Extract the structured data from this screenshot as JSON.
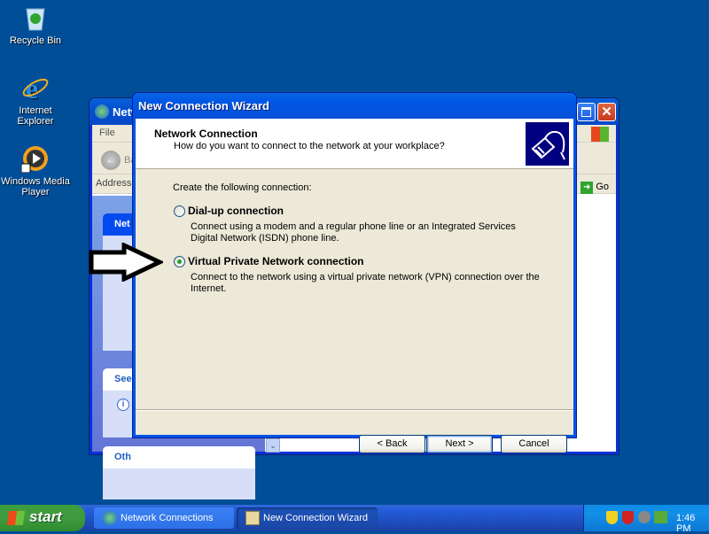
{
  "desktop": {
    "icons": [
      {
        "label": "Recycle Bin",
        "icon": "recycle-bin-icon"
      },
      {
        "label": "Internet Explorer",
        "icon": "internet-explorer-icon"
      },
      {
        "label": "Windows Media Player",
        "icon": "windows-media-player-icon"
      }
    ]
  },
  "background_window": {
    "title": "Network Connections",
    "title_visible": "Netw",
    "menu_file": "File",
    "back_label": "Ba",
    "address_label": "Address",
    "go_label": "Go",
    "panels": [
      "Net",
      "See",
      "Oth"
    ]
  },
  "wizard": {
    "title": "New Connection Wizard",
    "header_title": "Network Connection",
    "header_subtitle": "How do you want to connect to the network at your workplace?",
    "prompt": "Create the following connection:",
    "options": [
      {
        "label": "Dial-up connection",
        "description": "Connect using a modem and a regular phone line or an Integrated Services Digital Network (ISDN) phone line.",
        "selected": false
      },
      {
        "label": "Virtual Private Network connection",
        "description": "Connect to the network using a virtual private network (VPN) connection over the Internet.",
        "selected": true
      }
    ],
    "buttons": {
      "back": "< Back",
      "next": "Next >",
      "cancel": "Cancel"
    }
  },
  "taskbar": {
    "start_label": "start",
    "tasks": [
      {
        "label": "Network Connections",
        "active": false
      },
      {
        "label": "New Connection Wizard",
        "active": true
      }
    ],
    "clock": "1:46 PM"
  }
}
